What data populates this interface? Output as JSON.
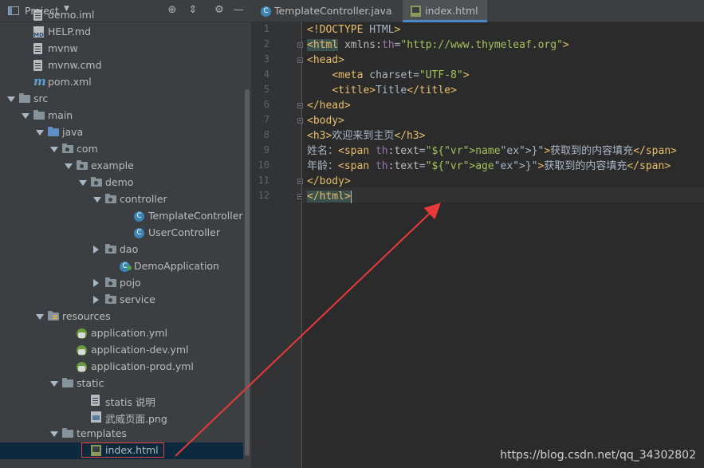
{
  "project_panel": {
    "title": "Project",
    "dropdown_glyph": "▼",
    "icons": [
      "target-icon",
      "collapse-icon",
      "gear-icon",
      "hide-icon"
    ]
  },
  "tree": [
    {
      "label": "demo.iml",
      "icon": "file-icon",
      "depth": 2,
      "arrow": "none"
    },
    {
      "label": "HELP.md",
      "icon": "markdown-icon",
      "depth": 2,
      "arrow": "none"
    },
    {
      "label": "mvnw",
      "icon": "file-icon",
      "depth": 2,
      "arrow": "none"
    },
    {
      "label": "mvnw.cmd",
      "icon": "file-icon",
      "depth": 2,
      "arrow": "none"
    },
    {
      "label": "pom.xml",
      "icon": "maven-icon",
      "depth": 2,
      "arrow": "none"
    },
    {
      "label": "src",
      "icon": "folder-icon",
      "depth": 1,
      "arrow": "open"
    },
    {
      "label": "main",
      "icon": "folder-icon",
      "depth": 2,
      "arrow": "open"
    },
    {
      "label": "java",
      "icon": "source-folder-icon",
      "depth": 3,
      "arrow": "open"
    },
    {
      "label": "com",
      "icon": "package-icon",
      "depth": 4,
      "arrow": "open"
    },
    {
      "label": "example",
      "icon": "package-icon",
      "depth": 5,
      "arrow": "open"
    },
    {
      "label": "demo",
      "icon": "package-icon",
      "depth": 6,
      "arrow": "open"
    },
    {
      "label": "controller",
      "icon": "package-icon",
      "depth": 7,
      "arrow": "open"
    },
    {
      "label": "TemplateController",
      "icon": "class-icon",
      "depth": 9,
      "arrow": "none"
    },
    {
      "label": "UserController",
      "icon": "class-icon",
      "depth": 9,
      "arrow": "none"
    },
    {
      "label": "dao",
      "icon": "package-icon",
      "depth": 7,
      "arrow": "closed"
    },
    {
      "label": "DemoApplication",
      "icon": "spring-class-icon",
      "depth": 8,
      "arrow": "none"
    },
    {
      "label": "pojo",
      "icon": "package-icon",
      "depth": 7,
      "arrow": "closed"
    },
    {
      "label": "service",
      "icon": "package-icon",
      "depth": 7,
      "arrow": "closed"
    },
    {
      "label": "resources",
      "icon": "resources-folder-icon",
      "depth": 3,
      "arrow": "open"
    },
    {
      "label": "application.yml",
      "icon": "spring-config-icon",
      "depth": 5,
      "arrow": "none"
    },
    {
      "label": "application-dev.yml",
      "icon": "spring-config-icon",
      "depth": 5,
      "arrow": "none"
    },
    {
      "label": "application-prod.yml",
      "icon": "spring-config-icon",
      "depth": 5,
      "arrow": "none"
    },
    {
      "label": "static",
      "icon": "folder-icon",
      "depth": 4,
      "arrow": "open"
    },
    {
      "label": "statis 说明",
      "icon": "file-icon",
      "depth": 6,
      "arrow": "none"
    },
    {
      "label": "武威页面.png",
      "icon": "image-icon",
      "depth": 6,
      "arrow": "none"
    },
    {
      "label": "templates",
      "icon": "folder-icon",
      "depth": 4,
      "arrow": "open"
    },
    {
      "label": "index.html",
      "icon": "html-icon",
      "depth": 6,
      "arrow": "none",
      "selected": true
    }
  ],
  "tabs": [
    {
      "label": "TemplateController.java",
      "icon": "class-icon",
      "active": false
    },
    {
      "label": "index.html",
      "icon": "html-icon",
      "active": true
    }
  ],
  "editor": {
    "line_numbers": [
      "1",
      "2",
      "3",
      "4",
      "5",
      "6",
      "7",
      "8",
      "9",
      "10",
      "11",
      "12"
    ],
    "lines": [
      "<!DOCTYPE HTML>",
      "<html xmlns:th=\"http://www.thymeleaf.org\">",
      "<head>",
      "    <meta charset=\"UTF-8\">",
      "    <title>Title</title>",
      "</head>",
      "<body>",
      "<h3>欢迎来到主页</h3>",
      "姓名：<span th:text=\"${name}\">获取到的内容填充</span>",
      "年龄：<span th:text=\"${age}\">获取到的内容填充</span>",
      "</body>",
      "</html>"
    ]
  },
  "watermark": "https://blog.csdn.net/qq_34302802",
  "colors": {
    "tag": "#e8bf6a",
    "attr": "#bababa",
    "value": "#a5c25c",
    "annotation_arrow": "#e83a3a",
    "selection_box": "#e04040"
  }
}
